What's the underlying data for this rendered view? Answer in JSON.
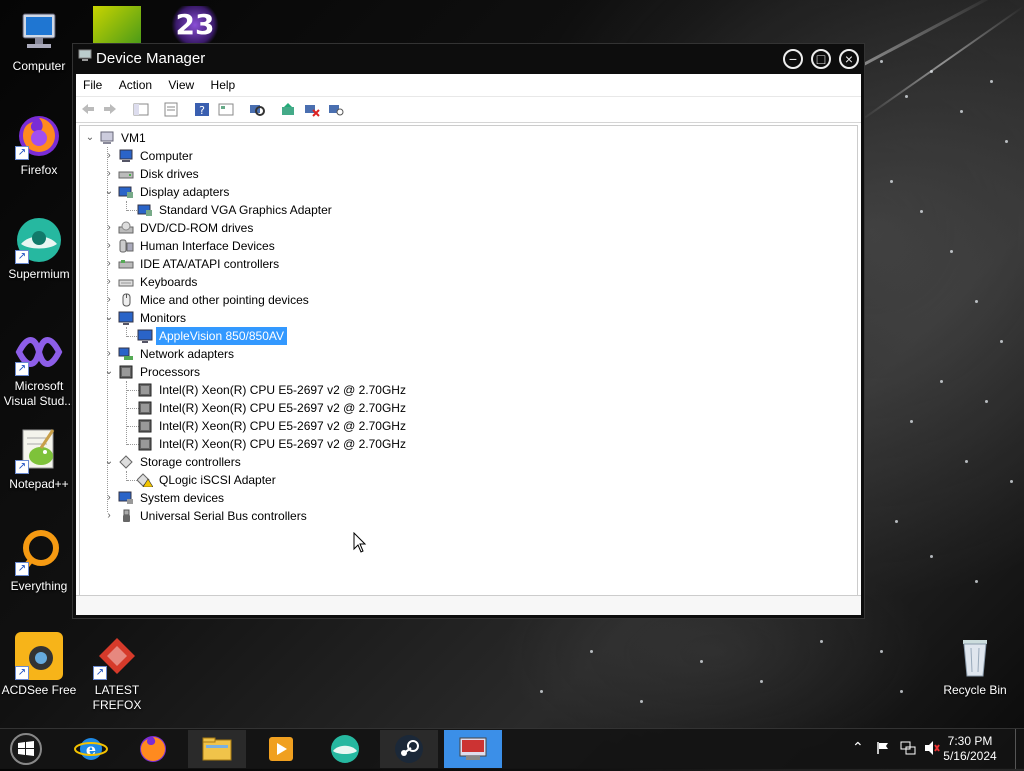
{
  "desktop": {
    "icons": [
      {
        "label": "Computer",
        "icon": "computer-icon"
      },
      {
        "label": "Firefox",
        "icon": "firefox-icon"
      },
      {
        "label": "Supermium",
        "icon": "supermium-icon"
      },
      {
        "label_line1": "Microsoft",
        "label_line2": "Visual Stud...",
        "icon": "visual-studio-icon"
      },
      {
        "label": "Notepad++",
        "icon": "notepadpp-icon"
      },
      {
        "label": "Everything",
        "icon": "everything-icon"
      },
      {
        "label": "ACDSee Free",
        "icon": "acdsee-icon"
      },
      {
        "label_line1": "LATEST",
        "label_line2": "FREFOX",
        "icon": "frefox-icon"
      },
      {
        "label": "Recycle Bin",
        "icon": "recycle-bin-icon"
      }
    ],
    "top_icon_number": "23"
  },
  "window": {
    "title": "Device Manager",
    "buttons": {
      "minimize": "−",
      "maximize": "□",
      "close": "×"
    },
    "menu": [
      "File",
      "Action",
      "View",
      "Help"
    ],
    "tree": {
      "root": "VM1",
      "items": [
        {
          "label": "Computer",
          "expanded": false
        },
        {
          "label": "Disk drives",
          "expanded": false
        },
        {
          "label": "Display adapters",
          "expanded": true,
          "children": [
            "Standard VGA Graphics Adapter"
          ]
        },
        {
          "label": "DVD/CD-ROM drives",
          "expanded": false
        },
        {
          "label": "Human Interface Devices",
          "expanded": false
        },
        {
          "label": "IDE ATA/ATAPI controllers",
          "expanded": false
        },
        {
          "label": "Keyboards",
          "expanded": false
        },
        {
          "label": "Mice and other pointing devices",
          "expanded": false
        },
        {
          "label": "Monitors",
          "expanded": true,
          "children": [
            "AppleVision 850/850AV"
          ]
        },
        {
          "label": "Network adapters",
          "expanded": false
        },
        {
          "label": "Processors",
          "expanded": true,
          "children": [
            "Intel(R) Xeon(R) CPU E5-2697 v2 @ 2.70GHz",
            "Intel(R) Xeon(R) CPU E5-2697 v2 @ 2.70GHz",
            "Intel(R) Xeon(R) CPU E5-2697 v2 @ 2.70GHz",
            "Intel(R) Xeon(R) CPU E5-2697 v2 @ 2.70GHz"
          ]
        },
        {
          "label": "Storage controllers",
          "expanded": true,
          "children": [
            "QLogic iSCSI Adapter"
          ]
        },
        {
          "label": "System devices",
          "expanded": false
        },
        {
          "label": "Universal Serial Bus controllers",
          "expanded": false
        }
      ],
      "selected": "AppleVision 850/850AV"
    }
  },
  "taskbar": {
    "apps": [
      "internet-explorer-icon",
      "firefox-icon",
      "file-explorer-icon",
      "media-player-icon",
      "supermium-icon",
      "steam-icon",
      "device-manager-icon"
    ],
    "clock": {
      "time": "7:30 PM",
      "date": "5/16/2024"
    }
  },
  "colors": {
    "selection": "#3399ff",
    "taskbar_active": "#3b8fe8"
  }
}
